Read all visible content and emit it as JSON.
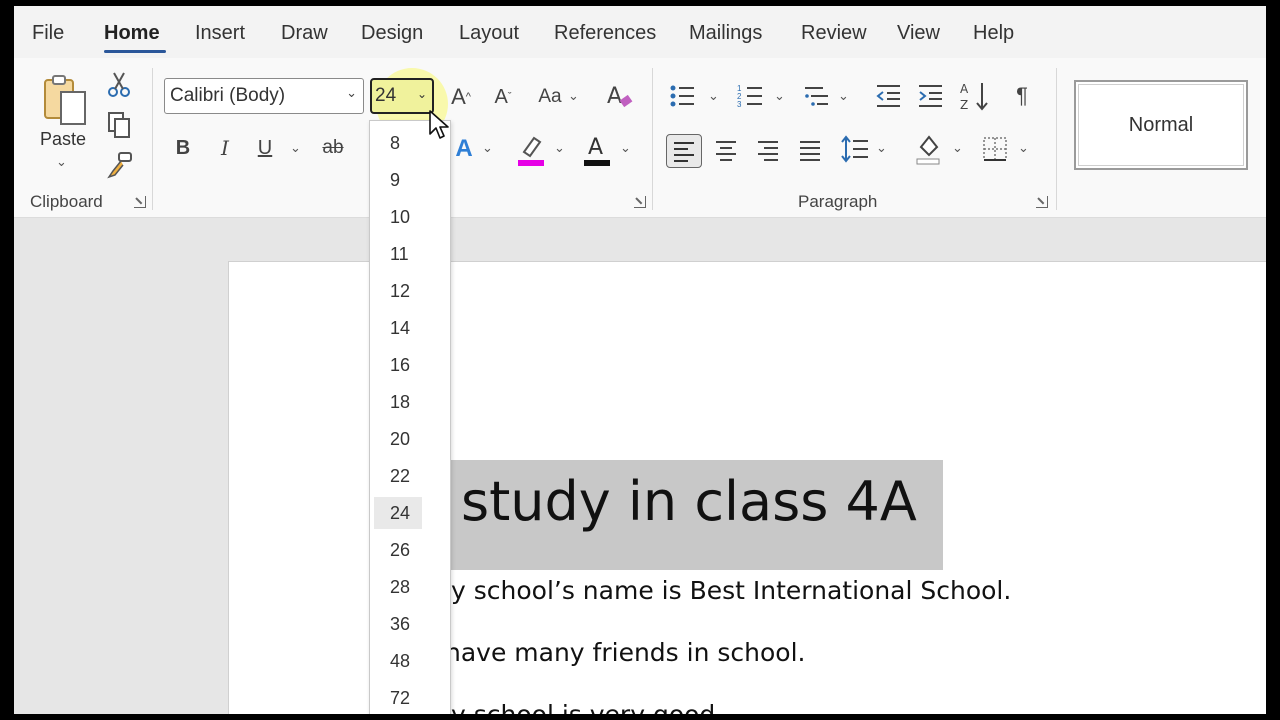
{
  "tabs": [
    "File",
    "Home",
    "Insert",
    "Draw",
    "Design",
    "Layout",
    "References",
    "Mailings",
    "Review",
    "View",
    "Help"
  ],
  "active_tab": "Home",
  "clipboard": {
    "paste_label": "Paste",
    "group_label": "Clipboard"
  },
  "font": {
    "name": "Calibri (Body)",
    "size": "24"
  },
  "paragraph": {
    "group_label": "Paragraph"
  },
  "styles": {
    "normal": "Normal"
  },
  "font_sizes": [
    "8",
    "9",
    "10",
    "11",
    "12",
    "14",
    "16",
    "18",
    "20",
    "22",
    "24",
    "26",
    "28",
    "36",
    "48",
    "72"
  ],
  "selected_size": "24",
  "document": {
    "heading": "study in class 4A",
    "lines": [
      "y school’s name is Best International School.",
      "have many friends in school.",
      "y school is very good."
    ]
  },
  "colors": {
    "highlight": "#e600e6",
    "font_color": "#111111",
    "accent": "#2b579a",
    "text_effects": "#2f7fd6"
  }
}
